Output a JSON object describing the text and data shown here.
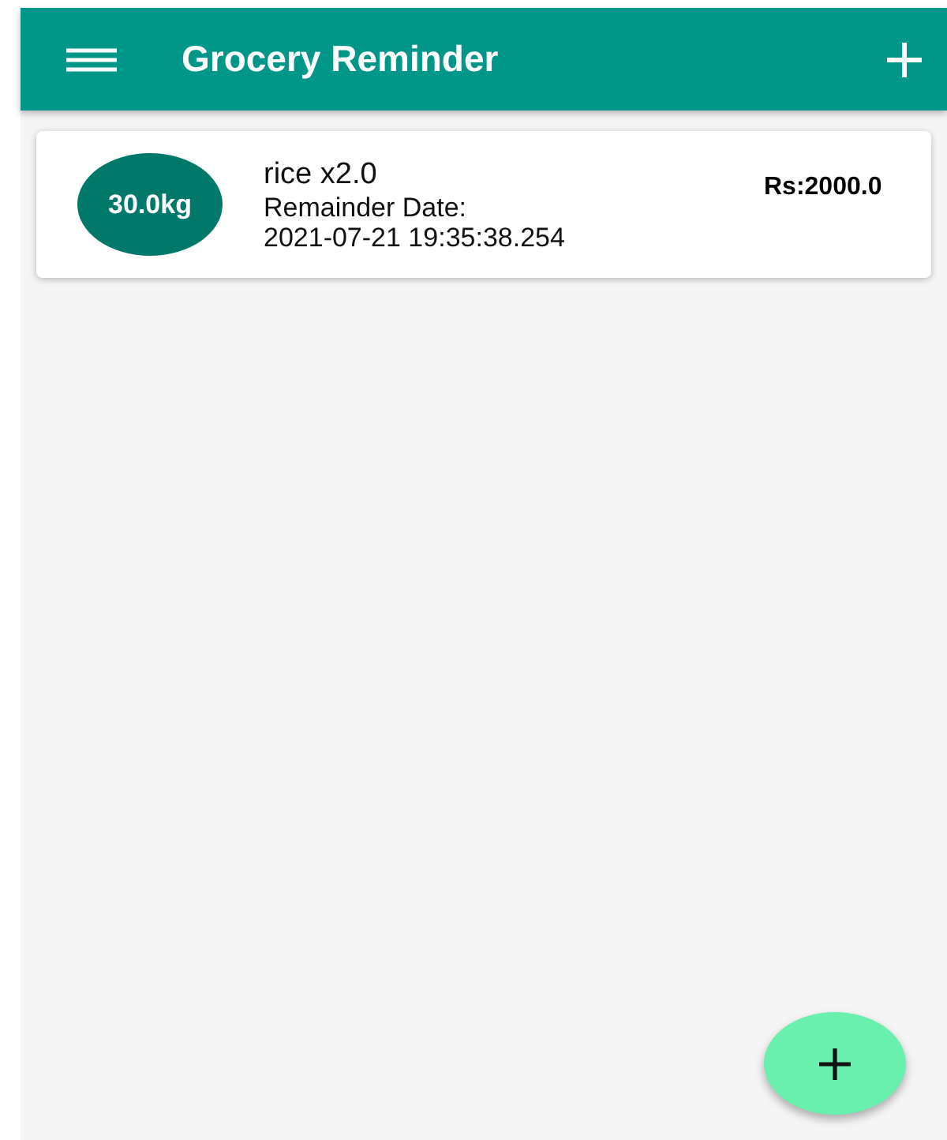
{
  "app_bar": {
    "title": "Grocery Reminder"
  },
  "items": [
    {
      "quantity": "30.0kg",
      "name": "rice x2.0",
      "date_label": "Remainder Date:",
      "date": "2021-07-21 19:35:38.254",
      "price": "Rs:2000.0"
    }
  ]
}
